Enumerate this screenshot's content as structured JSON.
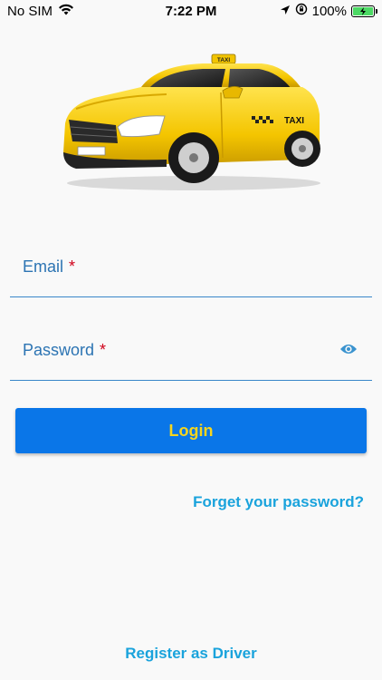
{
  "status_bar": {
    "carrier": "No SIM",
    "time": "7:22 PM",
    "battery": "100%",
    "battery_level": 1.0
  },
  "hero": {
    "taxi_sign": "TAXI",
    "door_text": "TAXI"
  },
  "form": {
    "email_label": "Email",
    "password_label": "Password",
    "required_marker": "*"
  },
  "actions": {
    "login_label": "Login",
    "forgot_label": "Forget your password?",
    "register_label": "Register as Driver"
  },
  "colors": {
    "primary_button": "#0a76e8",
    "button_text": "#f7d51d",
    "link": "#1aa3dc",
    "field_label": "#2c74b3",
    "required": "#d0021b"
  },
  "icons": {
    "wifi": "wifi-icon",
    "location": "location-arrow-icon",
    "lock_rotation": "orientation-lock-icon",
    "battery": "battery-charging-icon",
    "password_visibility": "eye-icon"
  }
}
